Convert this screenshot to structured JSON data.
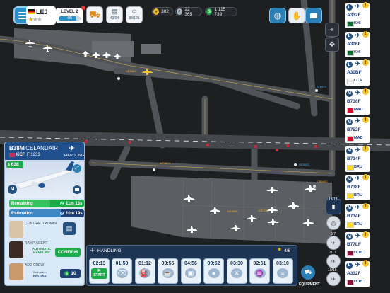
{
  "topbar": {
    "airport_code": "LEJ",
    "level_label": "LEVEL 2",
    "level_progress": "4/5",
    "level_progress_fraction": 0.8,
    "stars_filled": 1,
    "stars_total": 3,
    "counter_a": "43/94",
    "counter_b": "88/121",
    "currency_1": "302",
    "currency_2": "22 365",
    "currency_3": "1 115 739",
    "colors": {
      "accent": "#2d8ec7",
      "gold": "#e8b730",
      "green": "#1faa4a"
    }
  },
  "map": {
    "taxiway_labels": [
      "DE8563",
      "WF3674",
      "BL8474",
      "OE6532",
      "CB7239",
      "CB9402",
      "DE4506"
    ]
  },
  "flights": [
    {
      "tag": "L",
      "type": "A332F",
      "cc": "KHI",
      "flag": "pk"
    },
    {
      "tag": "L",
      "type": "A306F",
      "cc": "KHI",
      "flag": "pk"
    },
    {
      "tag": "L",
      "type": "A30BF",
      "cc": "LCA",
      "flag": "cy"
    },
    {
      "tag": "M",
      "type": "B738F",
      "cc": "MAD",
      "flag": "es"
    },
    {
      "tag": "M",
      "type": "B752F",
      "cc": "MAD",
      "flag": "es"
    },
    {
      "tag": "M",
      "type": "B734F",
      "cc": "BRU",
      "flag": "be"
    },
    {
      "tag": "M",
      "type": "B738F",
      "cc": "BRU",
      "flag": "be"
    },
    {
      "tag": "M",
      "type": "B734F",
      "cc": "BRU",
      "flag": "be"
    },
    {
      "tag": "M",
      "type": "B77LF",
      "cc": "DOH",
      "flag": "qa"
    },
    {
      "tag": "L",
      "type": "A332F",
      "cc": "DOH",
      "flag": "qa"
    }
  ],
  "side_counters": [
    "13/13",
    "0/7",
    "3/17",
    "10/16"
  ],
  "panel": {
    "aircraft": "B38M",
    "airline": "ICELANDAIR",
    "origin": "KEF",
    "flight": "FI1233",
    "mode": "HANDLING",
    "gate_value": "638",
    "badge": "M",
    "remaining_label": "Remaining",
    "remaining_value": "11m 13s",
    "remaining_fraction": 0.55,
    "estimation_label": "Estimation",
    "estimation_value": "10m 19s",
    "estimation_fraction": 0.7,
    "contract_label": "CONTRACT ADMIN",
    "ramp_label": "RAMP AGENT",
    "auto_label": "AUTOMATIC HANDLING",
    "confirm_label": "CONFIRM",
    "crew_label": "ADD CREW",
    "crew_estimation_label": "Estimation",
    "crew_estimation_value": "8m 15s",
    "crew_cost": "10"
  },
  "handling": {
    "title": "HANDLING",
    "staff_count": "4/6",
    "start_label": "START",
    "start_time": "02:13",
    "slots": [
      {
        "time": "01:50",
        "icon": "trash-icon"
      },
      {
        "time": "01:12",
        "icon": "fuel-icon"
      },
      {
        "time": "00:56",
        "icon": "catering-icon"
      },
      {
        "time": "04:56",
        "icon": "baggage-icon"
      },
      {
        "time": "00:52",
        "icon": "water-icon"
      },
      {
        "time": "03:30",
        "icon": "tools-icon"
      },
      {
        "time": "02:51",
        "icon": "cleaning-icon"
      },
      {
        "time": "03:10",
        "icon": "stairs-icon"
      }
    ],
    "equipment_label": "EQUIPMENT"
  }
}
